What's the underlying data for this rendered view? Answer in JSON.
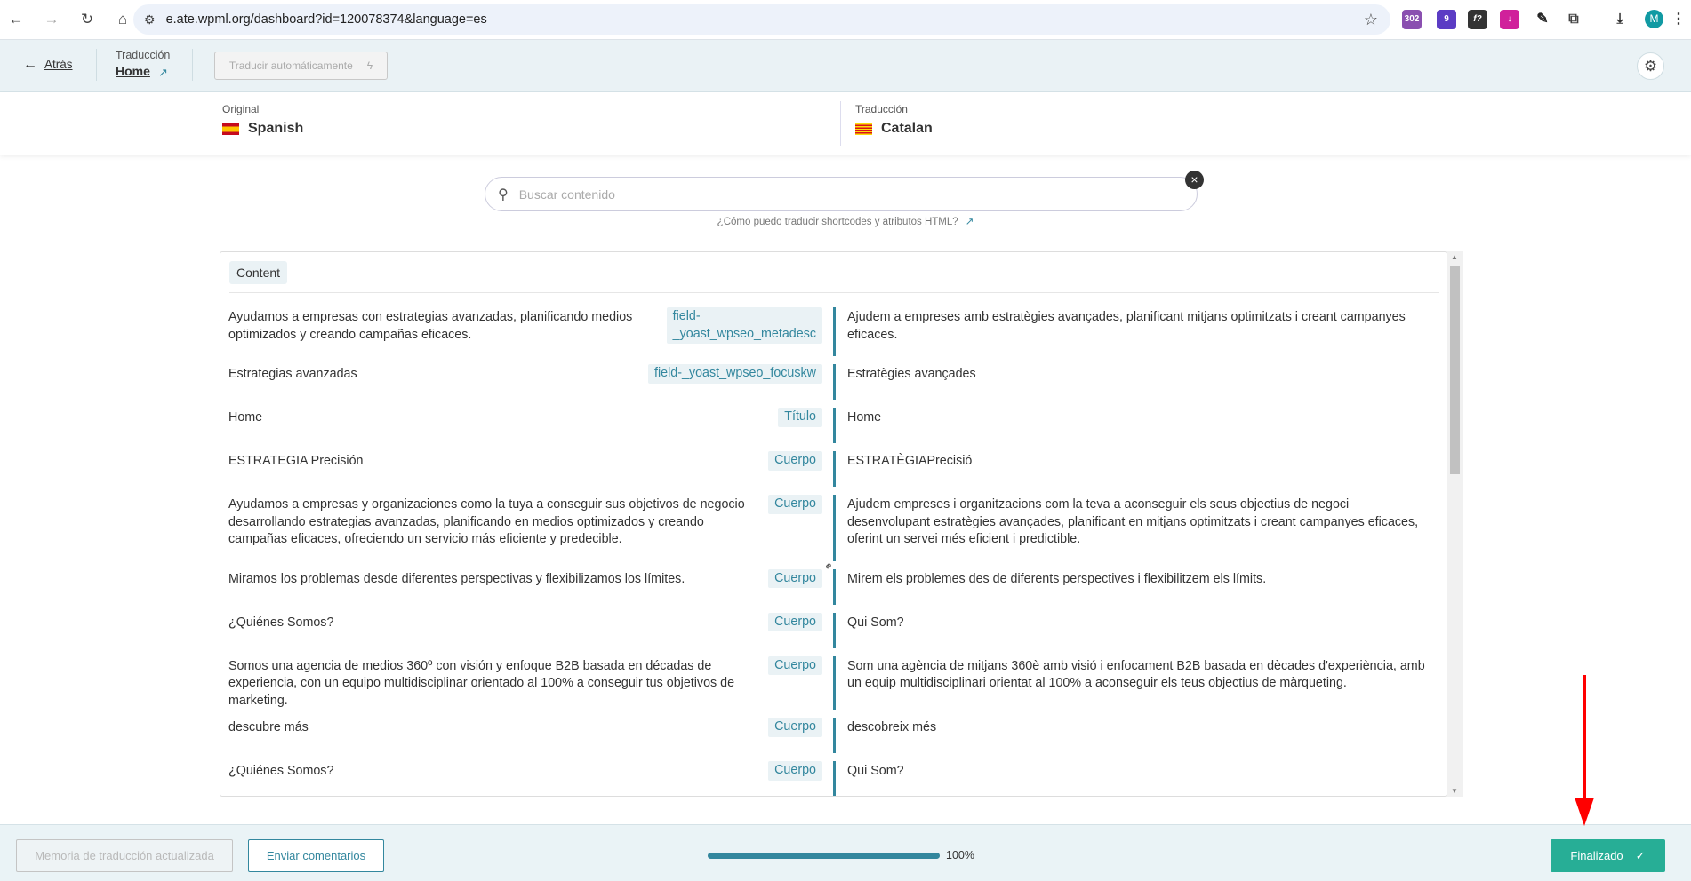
{
  "browser": {
    "url": "e.ate.wpml.org/dashboard?id=120078374&language=es",
    "ext_badge_1": "302",
    "ext_badge_2": "9",
    "ext_3": "f?",
    "avatar": "M"
  },
  "header": {
    "back": "Atrás",
    "translation_label": "Traducción",
    "page_name": "Home",
    "auto_translate": "Traducir automáticamente"
  },
  "languages": {
    "original_label": "Original",
    "original": "Spanish",
    "translation_label": "Traducción",
    "translation": "Catalan"
  },
  "search": {
    "placeholder": "Buscar contenido",
    "help_link": "¿Cómo puedo traducir shortcodes y atributos HTML?"
  },
  "content": {
    "section": "Content",
    "rows": [
      {
        "source": "Ayudamos a empresas con estrategias avanzadas, planificando medios optimizados y creando campañas eficaces.",
        "tag": "field-\n_yoast_wpseo_metadesc",
        "target": "Ajudem a empreses amb estratègies avançades, planificant mitjans optimitzats i creant campanyes eficaces."
      },
      {
        "source": "Estrategias avanzadas",
        "tag": "field-_yoast_wpseo_focuskw",
        "target": "Estratègies avançades"
      },
      {
        "source": "Home",
        "tag": "Título",
        "target": "Home"
      },
      {
        "source": "ESTRATEGIA Precisión",
        "tag": "Cuerpo",
        "target": "ESTRATÈGIAPrecisió"
      },
      {
        "source": "Ayudamos a empresas y organizaciones como la tuya a conseguir sus objetivos de negocio desarrollando estrategias avanzadas, planificando en medios optimizados y creando campañas eficaces, ofreciendo un servicio más eficiente y predecible.",
        "tag": "Cuerpo",
        "target": "Ajudem empreses i organitzacions com la teva a aconseguir els seus objectius de negoci desenvolupant estratègies avançades, planificant en mitjans optimitzats i creant campanyes eficaces, oferint un servei més eficient i predictible."
      },
      {
        "source": "Miramos los problemas desde diferentes perspectivas y flexibilizamos los límites.",
        "tag": "Cuerpo",
        "target": "Mirem els problemes des de diferents perspectives i flexibilitzem els límits."
      },
      {
        "source": "¿Quiénes Somos?",
        "tag": "Cuerpo",
        "target": "Qui Som?"
      },
      {
        "source": "Somos una agencia de medios 360º con visión y enfoque B2B basada en décadas de experiencia, con un equipo multidisciplinar orientado al 100% a conseguir tus objetivos de marketing.",
        "tag": "Cuerpo",
        "target": "Som una agència de mitjans 360è amb visió i enfocament B2B basada en dècades d'experiència, amb un equip multidisciplinari orientat al 100% a aconseguir els teus objectius de màrqueting."
      },
      {
        "source": "descubre más",
        "tag": "Cuerpo",
        "target": "descobreix més"
      },
      {
        "source": "¿Quiénes Somos?",
        "tag": "Cuerpo",
        "target": "Qui Som?"
      }
    ]
  },
  "footer": {
    "memory": "Memoria de traducción actualizada",
    "feedback": "Enviar comentarios",
    "progress": 100,
    "progress_label": "100%",
    "finish": "Finalizado"
  },
  "colors": {
    "accent": "#33879e",
    "finish": "#27ae96",
    "annotation": "#ff0000"
  }
}
